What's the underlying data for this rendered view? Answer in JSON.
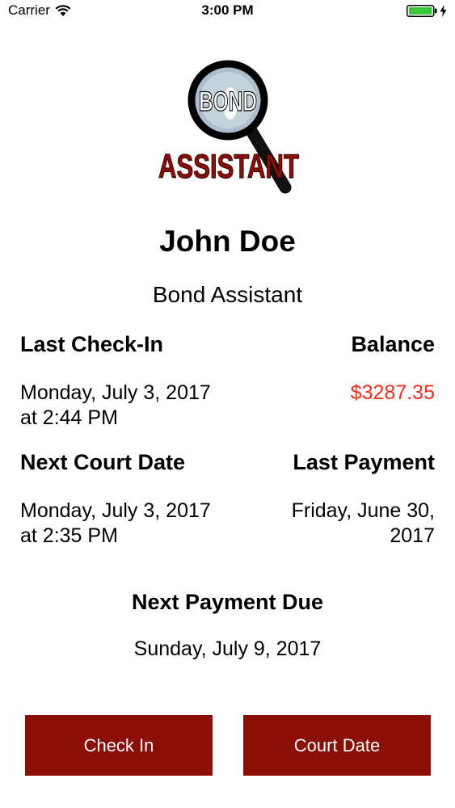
{
  "status_bar": {
    "carrier": "Carrier",
    "time": "3:00 PM"
  },
  "logo": {
    "top_text": "BOND",
    "bottom_text": "ASSISTANT",
    "color": "#8b0f06"
  },
  "profile": {
    "name": "John Doe",
    "role": "Bond Assistant"
  },
  "last_check_in": {
    "label": "Last Check-In",
    "date": "Monday, July 3, 2017",
    "time": "at 2:44 PM"
  },
  "balance": {
    "label": "Balance",
    "value": "$3287.35",
    "color": "#ff2a1a"
  },
  "next_court_date": {
    "label": "Next Court Date",
    "date": "Monday, July 3, 2017",
    "time": "at 2:35 PM"
  },
  "last_payment": {
    "label": "Last Payment",
    "line1": "Friday, June 30,",
    "line2": "2017"
  },
  "next_payment_due": {
    "label": "Next Payment Due",
    "value": "Sunday, July 9, 2017"
  },
  "actions": {
    "check_in": "Check In",
    "court_date": "Court Date"
  }
}
